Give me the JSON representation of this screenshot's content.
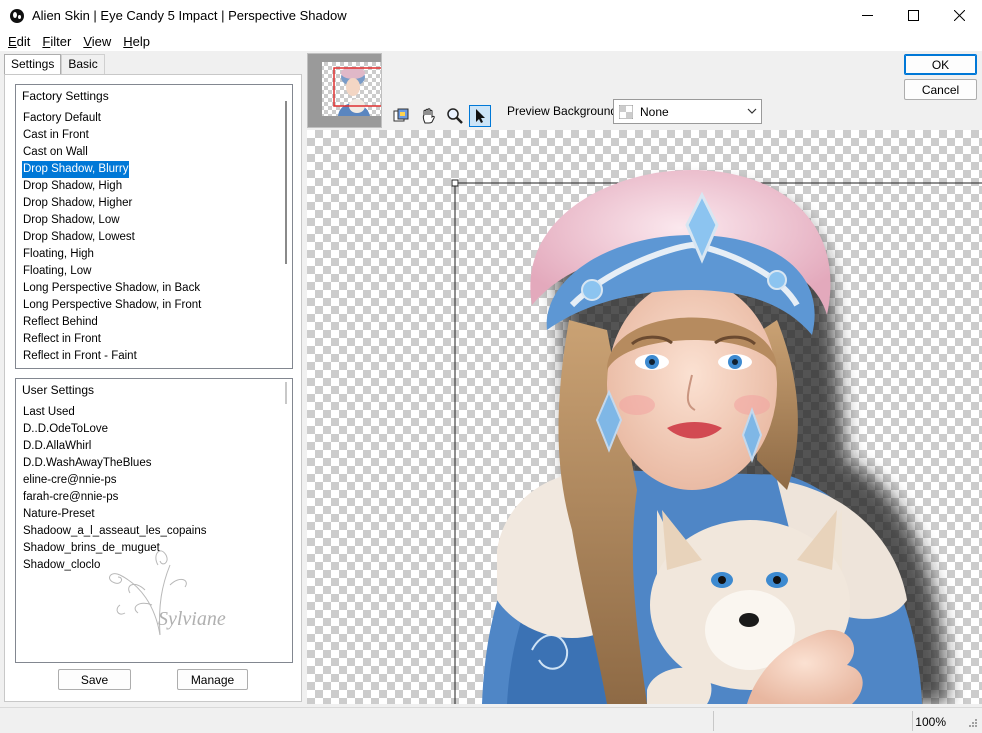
{
  "window": {
    "title": "Alien Skin | Eye Candy 5 Impact | Perspective Shadow"
  },
  "menu": [
    {
      "first": "E",
      "rest": "dit"
    },
    {
      "first": "F",
      "rest": "ilter"
    },
    {
      "first": "V",
      "rest": "iew"
    },
    {
      "first": "H",
      "rest": "elp"
    }
  ],
  "tabs": [
    "Settings",
    "Basic"
  ],
  "factory": {
    "header": "Factory Settings",
    "items": [
      "Factory Default",
      "Cast in Front",
      "Cast on Wall",
      "Drop Shadow, Blurry",
      "Drop Shadow, High",
      "Drop Shadow, Higher",
      "Drop Shadow, Low",
      "Drop Shadow, Lowest",
      "Floating, High",
      "Floating, Low",
      "Long Perspective Shadow, in Back",
      "Long Perspective Shadow, in Front",
      "Reflect Behind",
      "Reflect in Front",
      "Reflect in Front - Faint"
    ],
    "selected_index": 3
  },
  "user": {
    "header": "User Settings",
    "items": [
      "Last Used",
      "D..D.OdeToLove",
      "D.D.AllaWhirl",
      "D.D.WashAwayTheBlues",
      "eline-cre@nnie-ps",
      "farah-cre@nnie-ps",
      "Nature-Preset",
      "Shadoow_a_l_asseaut_les_copains",
      "Shadow_brins_de_muguet",
      "Shadow_cloclo"
    ],
    "watermark": "Sylviane"
  },
  "buttons": {
    "save": "Save",
    "manage": "Manage",
    "ok": "OK",
    "cancel": "Cancel"
  },
  "preview_background": {
    "label": "Preview Background:",
    "value": "None"
  },
  "status": {
    "zoom": "100%"
  },
  "colors": {
    "accent": "#0078d7",
    "selection": "#0078d7"
  }
}
